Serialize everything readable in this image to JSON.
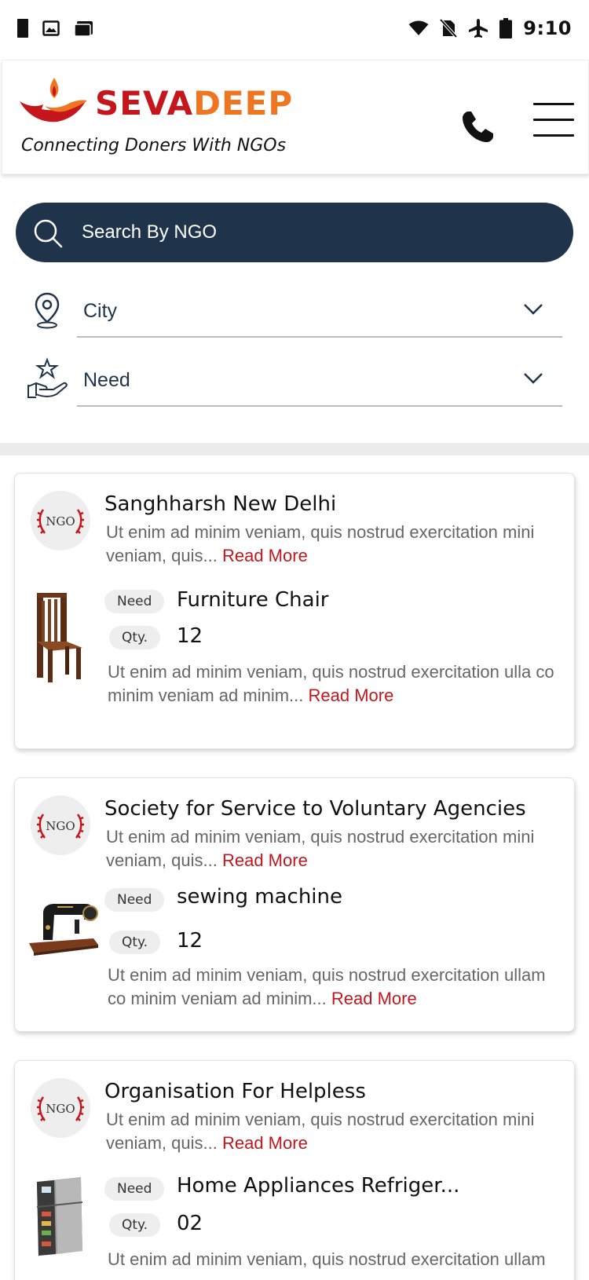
{
  "status_bar": {
    "time": "9:10",
    "left_icons": [
      "sim-card-icon",
      "image-icon",
      "briefcase-icon"
    ],
    "right_icons": [
      "wifi-icon",
      "no-sim-icon",
      "airplane-icon",
      "battery-icon"
    ]
  },
  "header": {
    "brand_part1": "SEVA",
    "brand_part2": "DEEP",
    "tagline": "Connecting Doners With NGOs",
    "colors": {
      "brand_red": "#c4161c",
      "brand_orange": "#ee7623"
    }
  },
  "search": {
    "placeholder": "Search By NGO",
    "background": "#1f344a"
  },
  "filters": [
    {
      "label": "City",
      "icon": "location-pin-icon"
    },
    {
      "label": "Need",
      "icon": "hand-star-icon"
    }
  ],
  "cards": [
    {
      "badge": "NGO",
      "title": "Sanghharsh New Delhi",
      "desc": "Ut enim ad minim veniam, quis nostrud exercitation mini veniam, quis...",
      "read_more": "Read More",
      "need_label": "Need",
      "need": "Furniture Chair",
      "qty_label": "Qty.",
      "qty": "12",
      "item_desc": "Ut enim ad minim veniam, quis nostrud exercitation ulla co minim veniam ad minim...",
      "item_read_more": "Read More",
      "image": "chair-icon"
    },
    {
      "badge": "NGO",
      "title": "Society for Service to Voluntary Agencies",
      "desc": "Ut enim ad minim veniam, quis nostrud exercitation mini veniam, quis...",
      "read_more": "Read More",
      "need_label": "Need",
      "need": "sewing machine",
      "qty_label": "Qty.",
      "qty": "12",
      "item_desc": "Ut enim ad minim veniam, quis nostrud exercitation ullam co minim veniam ad minim...",
      "item_read_more": "Read More",
      "image": "sewing-machine-icon"
    },
    {
      "badge": "NGO",
      "title": "Organisation For Helpless",
      "desc": "Ut enim ad minim veniam, quis nostrud exercitation mini veniam, quis...",
      "read_more": "Read More",
      "need_label": "Need",
      "need": "Home Appliances Refriger...",
      "qty_label": "Qty.",
      "qty": "02",
      "item_desc": "Ut enim ad minim veniam, quis nostrud exercitation ullam",
      "image": "refrigerator-icon"
    }
  ]
}
